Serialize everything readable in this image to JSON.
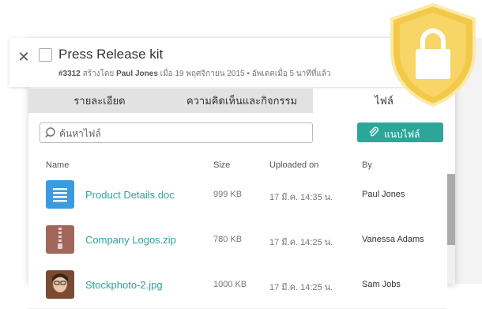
{
  "header": {
    "title": "Press Release kit",
    "meta_id": "#3312",
    "meta_created_prefix": "สร้างโดย",
    "meta_author": "Paul Jones",
    "meta_date": "เมื่อ 19 พฤศจิกายน 2015",
    "meta_separator": "•",
    "meta_updated": "อัพเดตเมื่อ 5 นาทีที่แล้ว"
  },
  "tabs": [
    {
      "label": "รายละเอียด",
      "active": false
    },
    {
      "label": "ความคิดเห็นและกิจกรรม",
      "active": false
    },
    {
      "label": "ไฟล์",
      "active": true
    }
  ],
  "search": {
    "placeholder": "ค้นหาไฟล์"
  },
  "attach_button": {
    "label": "แนบไฟล์"
  },
  "columns": {
    "name": "Name",
    "size": "Size",
    "uploaded": "Uploaded on",
    "by": "By"
  },
  "files": [
    {
      "name": "Product Details.doc",
      "size": "999 KB",
      "uploaded": "17 มี.ค. 14:35 น.",
      "by": "Paul Jones",
      "icon": "doc-file-icon"
    },
    {
      "name": "Company Logos.zip",
      "size": "780 KB",
      "uploaded": "17 มี.ค. 14:25 น.",
      "by": "Vanessa Adams",
      "icon": "zip-file-icon"
    },
    {
      "name": "Stockphoto-2.jpg",
      "size": "1000 KB",
      "uploaded": "17 มี.ค. 14:25 น.",
      "by": "Sam Jobs",
      "icon": "image-thumbnail"
    }
  ],
  "colors": {
    "accent": "#2da69a",
    "link": "#2ba3a0",
    "doc_icon": "#3b9be0",
    "zip_icon": "#a0675a",
    "shield": "#f3c94a"
  }
}
